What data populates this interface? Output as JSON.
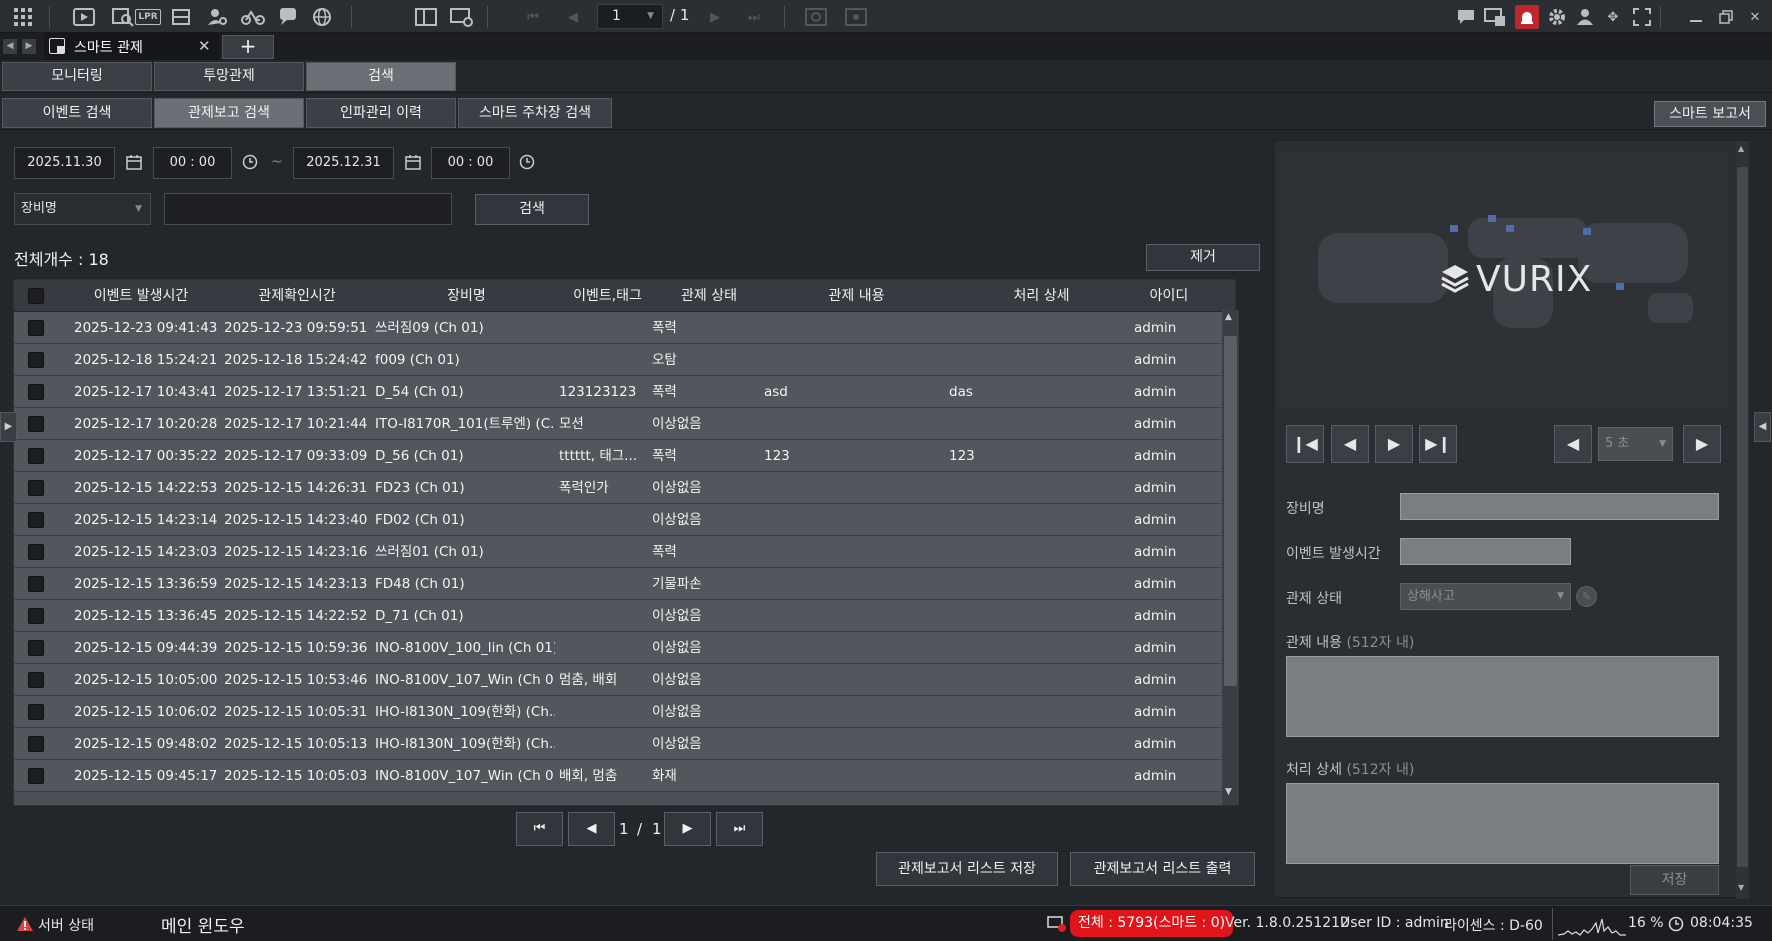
{
  "toolbar": {
    "page_current": "1",
    "page_total": "/ 1"
  },
  "tab": {
    "label": "스마트 관제",
    "add_icon": "+"
  },
  "menu": [
    "모니터링",
    "투망관제",
    "검색"
  ],
  "submenu": [
    "이벤트 검색",
    "관제보고 검색",
    "인파관리 이력",
    "스마트 주차장 검색"
  ],
  "smart_report": "스마트 보고서",
  "search": {
    "start_date": "2025.11.30",
    "start_time": "00 : 00",
    "sep": "~",
    "end_date": "2025.12.31",
    "end_time": "00 : 00",
    "filter_label": "장비명",
    "search_button": "검색"
  },
  "total_count": "전체개수 : 18",
  "remove_button": "제거",
  "columns": [
    "이벤트 발생시간",
    "관제확인시간",
    "장비명",
    "이벤트,태그",
    "관제 상태",
    "관제 내용",
    "처리 상세",
    "아이디"
  ],
  "rows": [
    [
      "2025-12-23 09:41:43",
      "2025-12-23 09:59:51",
      "쓰러짐09 (Ch 01)",
      "",
      "폭력",
      "",
      "",
      "admin"
    ],
    [
      "2025-12-18 15:24:21",
      "2025-12-18 15:24:42",
      "f009 (Ch 01)",
      "",
      "오탐",
      "",
      "",
      "admin"
    ],
    [
      "2025-12-17 10:43:41",
      "2025-12-17 13:51:21",
      "D_54 (Ch 01)",
      "123123123",
      "폭력",
      "asd",
      "das",
      "admin"
    ],
    [
      "2025-12-17 10:20:28",
      "2025-12-17 10:21:44",
      "ITO-I8170R_101(트루엔) (C...",
      "모션",
      "이상없음",
      "",
      "",
      "admin"
    ],
    [
      "2025-12-17 00:35:22",
      "2025-12-17 09:33:09",
      "D_56 (Ch 01)",
      "tttttt, 태그...",
      "폭력",
      "123",
      "123",
      "admin"
    ],
    [
      "2025-12-15 14:22:53",
      "2025-12-15 14:26:31",
      "FD23 (Ch 01)",
      "폭력인가",
      "이상없음",
      "",
      "",
      "admin"
    ],
    [
      "2025-12-15 14:23:14",
      "2025-12-15 14:23:40",
      "FD02 (Ch 01)",
      "",
      "이상없음",
      "",
      "",
      "admin"
    ],
    [
      "2025-12-15 14:23:03",
      "2025-12-15 14:23:16",
      "쓰러짐01 (Ch 01)",
      "",
      "폭력",
      "",
      "",
      "admin"
    ],
    [
      "2025-12-15 13:36:59",
      "2025-12-15 14:23:13",
      "FD48 (Ch 01)",
      "",
      "기물파손",
      "",
      "",
      "admin"
    ],
    [
      "2025-12-15 13:36:45",
      "2025-12-15 14:22:52",
      "D_71 (Ch 01)",
      "",
      "이상없음",
      "",
      "",
      "admin"
    ],
    [
      "2025-12-15 09:44:39",
      "2025-12-15 10:59:36",
      "INO-8100V_100_lin (Ch 01)",
      "",
      "이상없음",
      "",
      "",
      "admin"
    ],
    [
      "2025-12-15 10:05:00",
      "2025-12-15 10:53:46",
      "INO-8100V_107_Win (Ch 0...",
      "멈춤, 배회",
      "이상없음",
      "",
      "",
      "admin"
    ],
    [
      "2025-12-15 10:06:02",
      "2025-12-15 10:05:31",
      "IHO-I8130N_109(한화) (Ch...",
      "",
      "이상없음",
      "",
      "",
      "admin"
    ],
    [
      "2025-12-15 09:48:02",
      "2025-12-15 10:05:13",
      "IHO-I8130N_109(한화) (Ch...",
      "",
      "이상없음",
      "",
      "",
      "admin"
    ],
    [
      "2025-12-15 09:45:17",
      "2025-12-15 10:05:03",
      "INO-8100V_107_Win (Ch 0...",
      "배회, 멈춤",
      "화재",
      "",
      "",
      "admin"
    ]
  ],
  "pager": {
    "current": "1",
    "sep": "/",
    "total": "1"
  },
  "buttons": {
    "save_list": "관제보고서 리스트 저장",
    "print_list": "관제보고서 리스트 출력"
  },
  "preview": {
    "logo": "VURIX",
    "interval": "5 초"
  },
  "detail": {
    "device_label": "장비명",
    "time_label": "이벤트 발생시간",
    "status_label": "관제 상태",
    "status_value": "상해사고",
    "content_label": "관제 내용",
    "content_hint": "(512자 내)",
    "detail_label": "처리 상세",
    "detail_hint": "(512자 내)",
    "save_button": "저장"
  },
  "status": {
    "server": "서버 상태",
    "main_window": "메인 윈도우",
    "total": "전체 : 5793(스마트 : 0)",
    "version": "Ver. 1.8.0.251212",
    "user": "User ID : admin",
    "license": "라이센스 : D-60",
    "cpu": "16 %",
    "clock": "08:04:35"
  }
}
